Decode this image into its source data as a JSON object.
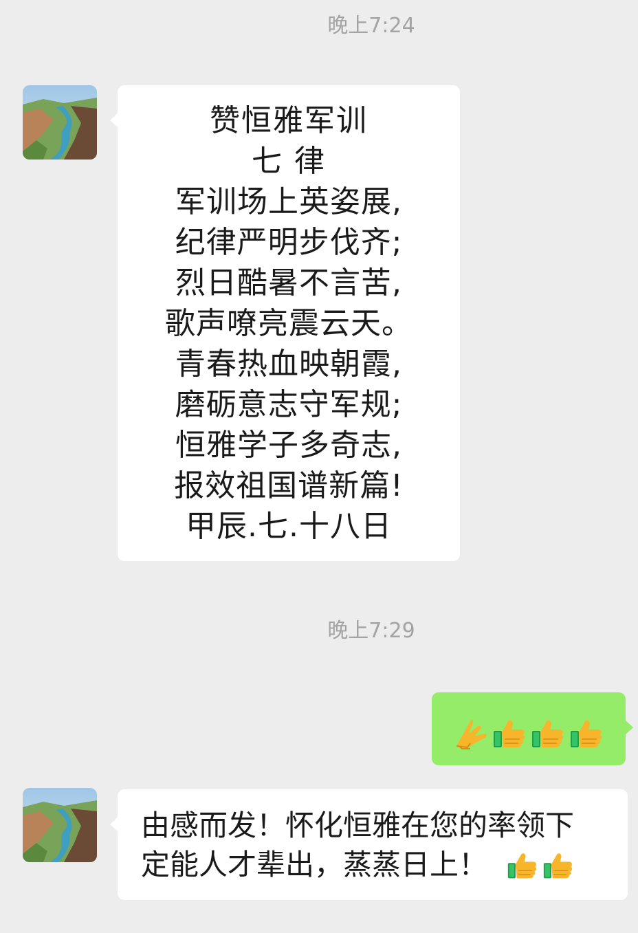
{
  "timestamps": [
    "晚上7:24",
    "晚上7:29"
  ],
  "messages": [
    {
      "sender": "other",
      "avatar": "landscape-avatar",
      "lines": [
        "赞恒雅军训",
        "七 律",
        "军训场上英姿展,",
        "纪律严明步伐齐;",
        "烈日酷暑不言苦,",
        "歌声嘹亮震云天。",
        "青春热血映朝霞,",
        "磨砺意志守军规;",
        "恒雅学子多奇志,",
        "报效祖国谱新篇!",
        "甲辰.七.十八日"
      ]
    },
    {
      "sender": "me",
      "emojis": [
        "pray-hands-icon",
        "thumbs-up-icon",
        "thumbs-up-icon",
        "thumbs-up-icon"
      ]
    },
    {
      "sender": "other",
      "avatar": "landscape-avatar",
      "lines": [
        "由感而发！怀化恒雅在您的率领下",
        "定能人才辈出，蒸蒸日上！"
      ],
      "trailing_emojis": [
        "thumbs-up-icon",
        "thumbs-up-icon"
      ]
    }
  ],
  "colors": {
    "background": "#ededed",
    "incoming_bubble": "#ffffff",
    "outgoing_bubble": "#95ec69",
    "timestamp_text": "#a3a3a3"
  }
}
